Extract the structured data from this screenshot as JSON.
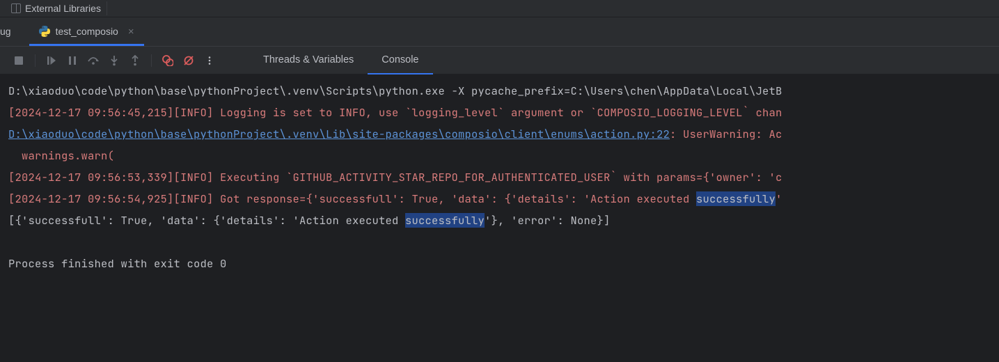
{
  "project_tree": {
    "external_libraries_label": "External Libraries"
  },
  "tabs": {
    "partial_tab": "ug",
    "active_tab_name": "test_composio"
  },
  "sub_tabs": {
    "threads": "Threads & Variables",
    "console": "Console"
  },
  "console_output": {
    "line1": "D:\\xiaoduo\\code\\python\\base\\pythonProject\\.venv\\Scripts\\python.exe -X pycache_prefix=C:\\Users\\chen\\AppData\\Local\\JetB",
    "line2": "[2024-12-17 09:56:45,215][INFO] Logging is set to INFO, use `logging_level` argument or `COMPOSIO_LOGGING_LEVEL` chan",
    "line3_link": "D:\\xiaoduo\\code\\python\\base\\pythonProject\\.venv\\Lib\\site-packages\\composio\\client\\enums\\action.py:22",
    "line3_tail": ": UserWarning: Ac",
    "line4": "  warnings.warn(",
    "line5": "[2024-12-17 09:56:53,339][INFO] Executing `GITHUB_ACTIVITY_STAR_REPO_FOR_AUTHENTICATED_USER` with params={'owner': 'c",
    "line6_pre": "[2024-12-17 09:56:54,925][INFO] Got response={'successfull': True, 'data': {'details': 'Action executed ",
    "line6_hl": "successfully",
    "line6_post": "'",
    "line7_pre": "[{'successfull': True, 'data': {'details': 'Action executed ",
    "line7_hl": "successfully",
    "line7_post": "'}, 'error': None}]",
    "blank": "",
    "line8": "Process finished with exit code 0"
  }
}
